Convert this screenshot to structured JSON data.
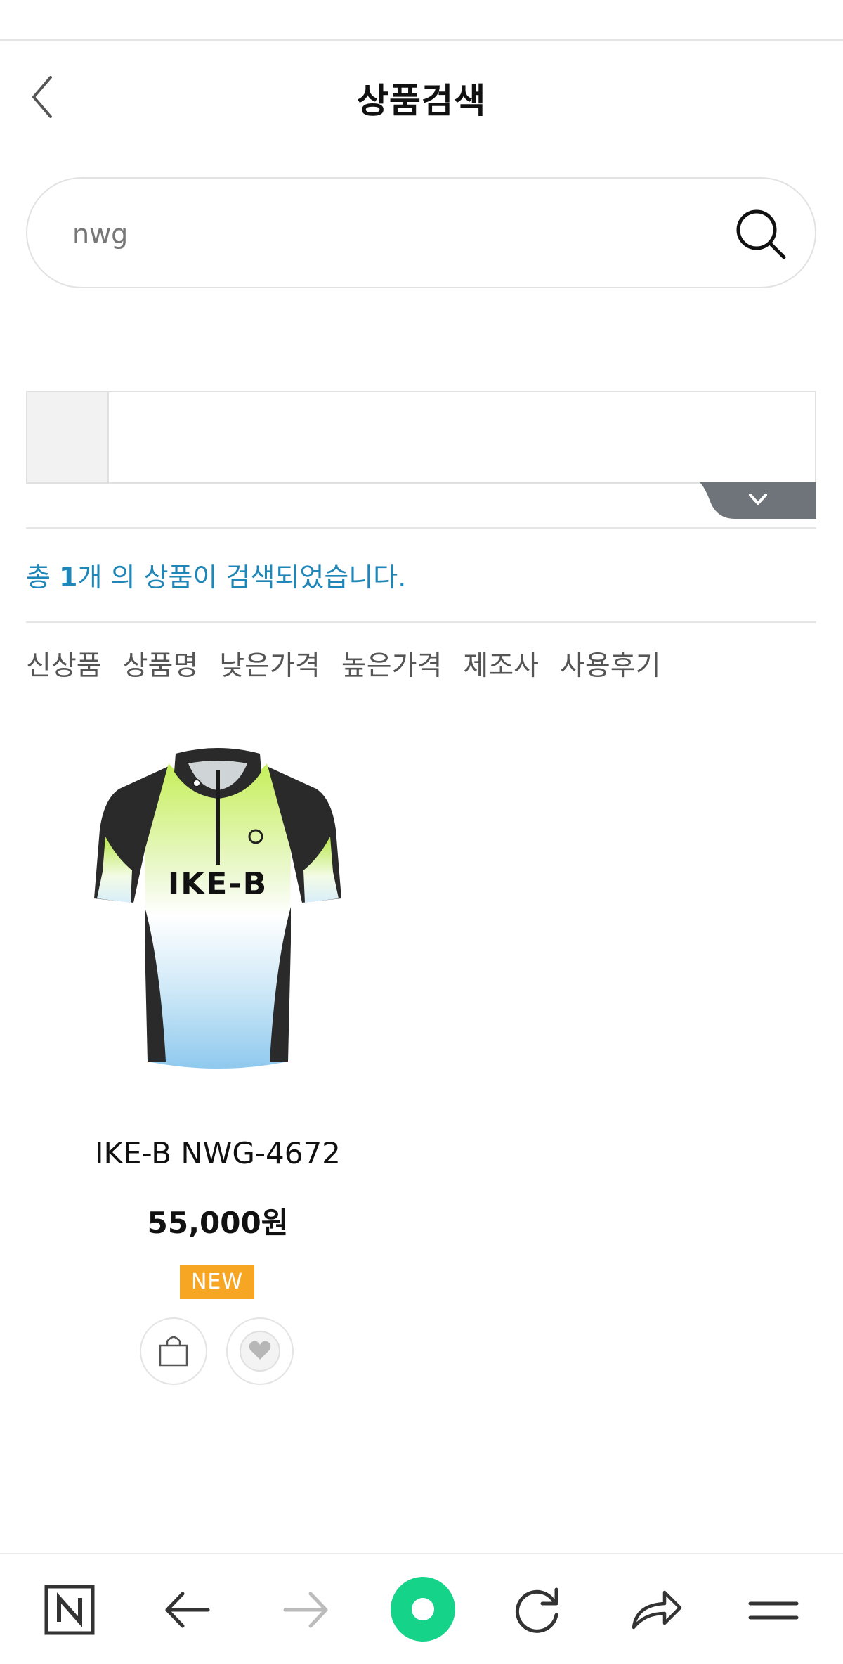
{
  "header": {
    "title": "상품검색",
    "back_icon": "chevron-left-icon"
  },
  "search": {
    "value": "nwg",
    "placeholder": "",
    "icon": "search-icon"
  },
  "results": {
    "prefix": "총 ",
    "count": "1",
    "suffix": "개 의 상품이 검색되었습니다."
  },
  "sort_tabs": [
    "신상품",
    "상품명",
    "낮은가격",
    "높은가격",
    "제조사",
    "사용후기"
  ],
  "product": {
    "name": "IKE-B NWG-4672",
    "price": "55,000원",
    "badge": "NEW",
    "jersey_text": "IKE-B",
    "actions": [
      "cart-icon",
      "heart-icon"
    ]
  },
  "bottom_nav": [
    "naver-icon",
    "back-arrow-icon",
    "forward-arrow-icon",
    "home-circle-icon",
    "refresh-icon",
    "share-icon",
    "menu-icon"
  ],
  "colors": {
    "accent": "#1f86b8",
    "badge": "#f6a623",
    "home_green": "#16d38a"
  }
}
